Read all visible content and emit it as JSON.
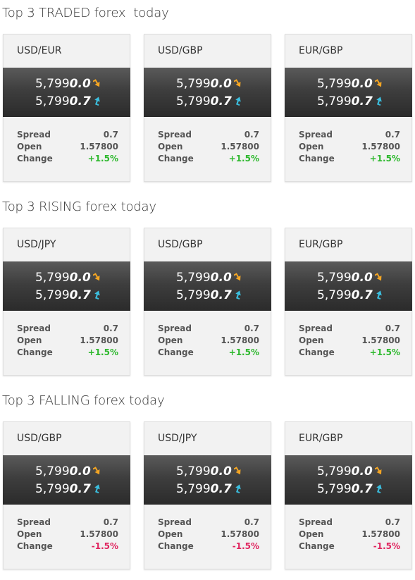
{
  "stat_labels": {
    "spread": "Spread",
    "open": "Open",
    "change": "Change"
  },
  "colors": {
    "change_up": "#2db82d",
    "change_down": "#e0245e",
    "arrow_down": "#f5a623",
    "arrow_up": "#3bbfdf"
  },
  "sections": [
    {
      "title": "Top 3 TRADED forex  today",
      "cards": [
        {
          "pair": "USD/EUR",
          "bid_main": "5,799",
          "bid_big": "0.0",
          "bid_icon": "arrow-down-icon",
          "ask_main": "5,799",
          "ask_big": "0.7",
          "ask_icon": "arrow-up-icon",
          "spread": "0.7",
          "open": "1.57800",
          "change": "+1.5%"
        },
        {
          "pair": "USD/GBP",
          "bid_main": "5,799",
          "bid_big": "0.0",
          "bid_icon": "arrow-down-icon",
          "ask_main": "5,799",
          "ask_big": "0.7",
          "ask_icon": "arrow-up-icon",
          "spread": "0.7",
          "open": "1.57800",
          "change": "+1.5%"
        },
        {
          "pair": "EUR/GBP",
          "bid_main": "5,799",
          "bid_big": "0.0",
          "bid_icon": "arrow-down-icon",
          "ask_main": "5,799",
          "ask_big": "0.7",
          "ask_icon": "arrow-up-icon",
          "spread": "0.7",
          "open": "1.57800",
          "change": "+1.5%"
        }
      ]
    },
    {
      "title": "Top 3 RISING forex today",
      "cards": [
        {
          "pair": "USD/JPY",
          "bid_main": "5,799",
          "bid_big": "0.0",
          "bid_icon": "arrow-down-icon",
          "ask_main": "5,799",
          "ask_big": "0.7",
          "ask_icon": "arrow-up-icon",
          "spread": "0.7",
          "open": "1.57800",
          "change": "+1.5%"
        },
        {
          "pair": "USD/GBP",
          "bid_main": "5,799",
          "bid_big": "0.0",
          "bid_icon": "arrow-down-icon",
          "ask_main": "5,799",
          "ask_big": "0.7",
          "ask_icon": "arrow-up-icon",
          "spread": "0.7",
          "open": "1.57800",
          "change": "+1.5%"
        },
        {
          "pair": "EUR/GBP",
          "bid_main": "5,799",
          "bid_big": "0.0",
          "bid_icon": "arrow-down-icon",
          "ask_main": "5,799",
          "ask_big": "0.7",
          "ask_icon": "arrow-up-icon",
          "spread": "0.7",
          "open": "1.57800",
          "change": "+1.5%"
        }
      ]
    },
    {
      "title": "Top 3 FALLING forex today",
      "cards": [
        {
          "pair": "USD/GBP",
          "bid_main": "5,799",
          "bid_big": "0.0",
          "bid_icon": "arrow-down-icon",
          "ask_main": "5,799",
          "ask_big": "0.7",
          "ask_icon": "arrow-up-icon",
          "spread": "0.7",
          "open": "1.57800",
          "change": "-1.5%"
        },
        {
          "pair": "USD/JPY",
          "bid_main": "5,799",
          "bid_big": "0.0",
          "bid_icon": "arrow-down-icon",
          "ask_main": "5,799",
          "ask_big": "0.7",
          "ask_icon": "arrow-up-icon",
          "spread": "0.7",
          "open": "1.57800",
          "change": "-1.5%"
        },
        {
          "pair": "EUR/GBP",
          "bid_main": "5,799",
          "bid_big": "0.0",
          "bid_icon": "arrow-down-icon",
          "ask_main": "5,799",
          "ask_big": "0.7",
          "ask_icon": "arrow-up-icon",
          "spread": "0.7",
          "open": "1.57800",
          "change": "-1.5%"
        }
      ]
    }
  ]
}
